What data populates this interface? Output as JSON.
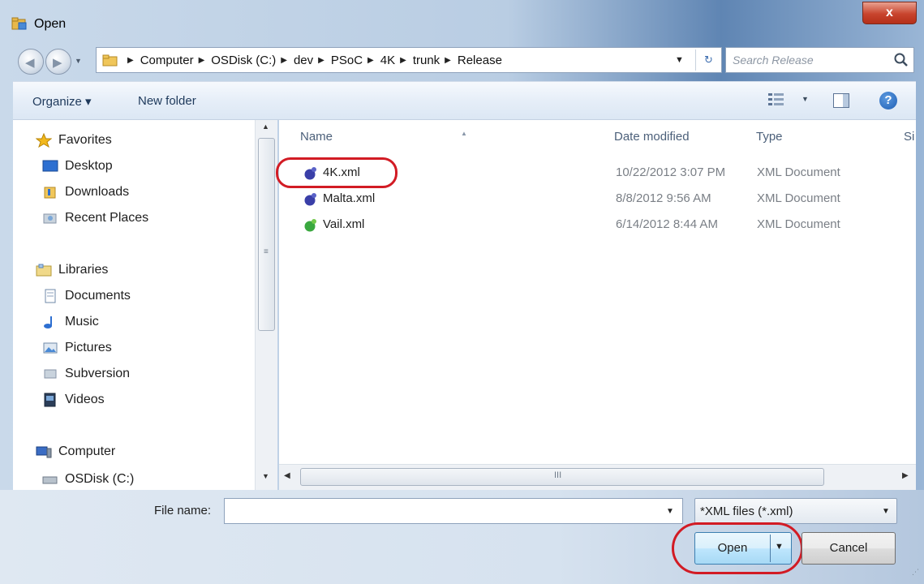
{
  "window": {
    "title": "Open",
    "close_glyph": "x",
    "app_icon": "open-folder-icon"
  },
  "nav": {
    "back_icon": "back-arrow-icon",
    "forward_icon": "forward-arrow-icon",
    "breadcrumbs": [
      "Computer",
      "OSDisk (C:)",
      "dev",
      "PSoC",
      "4K",
      "trunk",
      "Release"
    ],
    "search_placeholder": "Search Release",
    "search_icon": "search-icon"
  },
  "toolbar": {
    "organize_label": "Organize ▾",
    "new_folder_label": "New folder",
    "help_glyph": "?"
  },
  "sidebar": {
    "favorites_label": "Favorites",
    "favorites": [
      "Desktop",
      "Downloads",
      "Recent Places"
    ],
    "libraries_label": "Libraries",
    "libraries": [
      "Documents",
      "Music",
      "Pictures",
      "Subversion",
      "Videos"
    ],
    "computer_label": "Computer",
    "computer_items": [
      "OSDisk (C:)"
    ]
  },
  "filelist": {
    "columns": [
      "Name",
      "Date modified",
      "Type",
      "Si"
    ],
    "rows": [
      {
        "name": "4K.xml",
        "date": "10/22/2012 3:07 PM",
        "type": "XML Document",
        "icon_color": "#3a3fa8"
      },
      {
        "name": "Malta.xml",
        "date": "8/8/2012 9:56 AM",
        "type": "XML Document",
        "icon_color": "#3a3fa8"
      },
      {
        "name": "Vail.xml",
        "date": "6/14/2012 8:44 AM",
        "type": "XML Document",
        "icon_color": "#3aa83f"
      }
    ],
    "scroll_grip": "III"
  },
  "footer": {
    "file_name_label": "File name:",
    "file_name_value": "",
    "filter_value": "*XML files (*.xml)",
    "open_label": "Open",
    "cancel_label": "Cancel"
  },
  "colors": {
    "highlight_ring": "#d21b24",
    "accent": "#3c7fb1"
  }
}
